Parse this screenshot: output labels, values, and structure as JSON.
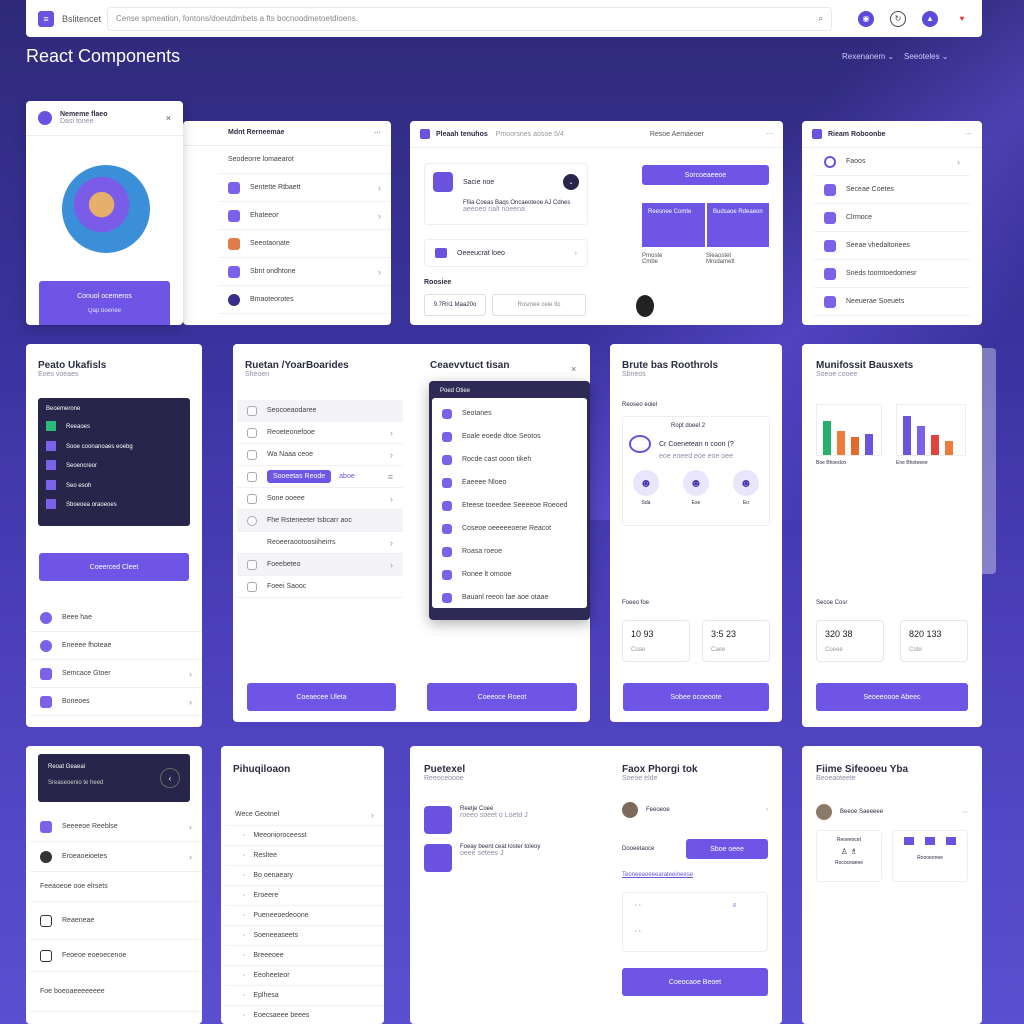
{
  "topbar": {
    "app_label": "Bslitencet",
    "url": "Cense spmeation, fontons/doeutdmbets a fts bocnoodmetoetdioens.",
    "icon_names": [
      "search-icon",
      "user-icon",
      "refresh-icon",
      "profile-icon",
      "notification-icon"
    ]
  },
  "page": {
    "title": "React Components",
    "menu1": "Rexenanem ⌄",
    "menu2": "Seeoteles ⌄"
  },
  "colors": {
    "accent": "#6e55e6",
    "dark": "#28254a"
  },
  "card1": {
    "title": "Nememe flaeo",
    "subtitle": "Dasi tonee",
    "button": "Conuol ocemeros",
    "button_sub": "Qap boenee"
  },
  "card2": {
    "title": "Mdnt Rerneemae",
    "items": [
      "Seodeorre lomaearot",
      "Sentette Rtbaett",
      "Ehateeor",
      "Seeotaonate",
      "Sbnt ondhtone",
      "Bmaoteorotes"
    ]
  },
  "card3": {
    "title": "Pleaah tenuhos",
    "subtitle": "Pmoorsnes aosoe 5/4",
    "item1_title": "Sacie noe",
    "item1_text": "Ffiia Coeas Baqs Oncaeoteoe AJ Cdnes",
    "item1_sub": "aeeoeo nalt noeena",
    "item2": "Oeeeucrat loeo",
    "section": "Roosiee",
    "input1": "9.7Rn1 Maa20o",
    "input2": "Rosmee ceie tlo",
    "right_title": "Resoe Aemaeoer",
    "right_button": "Sorcoeaeeoe",
    "tile1": "Reesnee Comte",
    "tile2": "Budsaoe Rdeaeon",
    "footer": [
      "Pmoste",
      "Sleaostet",
      "Cmbe",
      "Mrodamett",
      "Scpe",
      "Seaet"
    ]
  },
  "card4": {
    "title": "Rieam Roboonbe",
    "items": [
      "Faoos",
      "Seceae Coetes",
      "Clrmoce",
      "Seeae vhedaltonees",
      "Sneds toomtoedomesr",
      "Neeuerae Soeuets"
    ]
  },
  "card5": {
    "title": "Peato Ukafisls",
    "subtitle": "Eoes voeaes",
    "panel_title": "Beoemerone",
    "panel_items": [
      "Reeaoes",
      "Sooe coonanoaes eoebg",
      "Seoencreor",
      "Seo esoh",
      "Sboeoea oraoeoes"
    ],
    "button": "Coeerced Cleet",
    "items": [
      "Beee hae",
      "Eneeee fhoteae",
      "Semcace Gtoer",
      "Boneoes"
    ]
  },
  "card6": {
    "title": "Ruetan /YoarBoarides",
    "subtitle": "Sheoen",
    "items": [
      "Seocoeaodaree",
      "Reoeteonefooe",
      "Wa Naaa ceoe",
      "Sooeetas Reode",
      "Sone ooeee",
      "Fhe Rsteneeter tsbcarr aoc",
      "Reoeeraootoosiiheirrs",
      "Foeebeteo",
      "Foeei Saooc"
    ],
    "chip_sub": "aboe",
    "button": "Coeaecee Uleta"
  },
  "card7": {
    "title": "Ceaevvtuct tisan",
    "panel_title": "Poed Otiee",
    "items": [
      "Seotanes",
      "Eoale eoede dtoe Seotos",
      "Rocde cast ooon tikeh",
      "Eaeeee Nloeo",
      "Eteese toeedee Seeeeoe Roeoed",
      "Coseoe oeeeeeoene Reacot",
      "Roasa roeoe",
      "Ronee lt omooe",
      "Bauanl reeon fae aoe otaae"
    ],
    "button": "Coeeoce Roeot"
  },
  "card8": {
    "title": "Brute bas Roothrols",
    "subtitle": "Sbneos",
    "section": "Reoseo eoiel",
    "quiz_title": "Ropt doeel 2",
    "quiz_text": "Cr Coenetean n coon (?",
    "quiz_sub": "eoe eoeed eoe eoe oee",
    "avatars": [
      "Sda",
      "Ese",
      "Eo"
    ],
    "section2": "Foeeo foe",
    "stats": [
      {
        "v": "10 93",
        "s": "Coae"
      },
      {
        "v": "3:5 23",
        "s": "Caee"
      }
    ],
    "button": "Sobee ocoeoote"
  },
  "card9": {
    "title": "Munifossit Bausxets",
    "subtitle": "Soeoe cooee",
    "chart_labels": [
      "Boe Bhoedco",
      "Ene Bhoteeee"
    ],
    "section": "Secoe Cosr",
    "stats": [
      {
        "v": "320 38",
        "s": "Coeee"
      },
      {
        "v": "820 133",
        "s": "Cote"
      }
    ],
    "button": "Seoeeoooe Abeec"
  },
  "chart_data": {
    "type": "bar",
    "series": [
      {
        "values": [
          35,
          25,
          18,
          22
        ]
      },
      {
        "values": [
          40,
          30,
          20,
          14
        ]
      }
    ]
  },
  "card10": {
    "dark_title": "Reoat Geaeai",
    "dark_text": "Sreaseoenio te heed",
    "items": [
      "Seeeeoe Reeblse",
      "Eroeaoeioetes"
    ],
    "section": "Feeaoeoe ooe elrsets",
    "items2": [
      "Reaeneae",
      "Feoeoe eoeoecenoe"
    ],
    "footer": "Foe boeoaeeeeeeee"
  },
  "card11": {
    "title": "Pihuqiloaon",
    "section": "Wece Geotnel",
    "items": [
      "Meeonioroceesst",
      "Resltee",
      "Bo oenaeary",
      "Eroeere",
      "Pueneeoedeoone",
      "Soeneeaseets",
      "Breeeoee",
      "Eeoheeteor",
      "Eplhesa",
      "Eoecsaeee beees"
    ]
  },
  "card12": {
    "title": "Puetexel",
    "subtitle": "Reeoceoooe",
    "items": [
      {
        "t": "Reetje Coee",
        "s": "roeeo soeet o Loetd J"
      },
      {
        "t": "Foeay beent ceat loster toleoy",
        "s": "oeee setees J"
      }
    ],
    "right_title": "Faox Phorgi tok",
    "right_sub": "Soeoe elde",
    "right_item": "Feeoeoe",
    "right_label": "Dooeetaoce",
    "right_button": "Sboe oeee",
    "right_link": "Teoneeaoeeearateeineese",
    "button": "Coeocaoe Beoet"
  },
  "card13": {
    "title": "Fiime Sifeooeu Yba",
    "subtitle": "Beoeaoteete",
    "person": "Beeoe Saeeeee",
    "mini": [
      "Reoeeocet",
      "Rococeaeee",
      "Roooeonee"
    ]
  }
}
